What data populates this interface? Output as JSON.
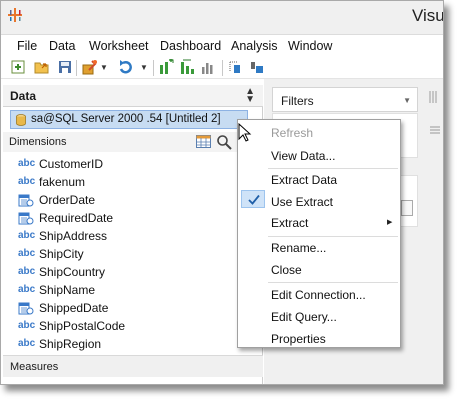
{
  "window": {
    "title_partial": "Visu"
  },
  "menubar": {
    "items": [
      "File",
      "Data",
      "Worksheet",
      "Dashboard",
      "Analysis",
      "Window"
    ]
  },
  "toolbar": {
    "icons": [
      "new-sheet-icon",
      "open-icon",
      "save-icon",
      "new-data-source-icon",
      "redo-icon",
      "swap-rows-cols-icon",
      "sort-icon",
      "bar-chart-icon",
      "group-icon",
      "label-icon"
    ]
  },
  "data_pane": {
    "title": "Data",
    "connection": "sa@SQL Server 2000 .54 [Untitled 2]",
    "dimensions_label": "Dimensions",
    "measures_label": "Measures",
    "fields": [
      {
        "type": "abc",
        "name": "CustomerID"
      },
      {
        "type": "abc",
        "name": "fakenum"
      },
      {
        "type": "date",
        "name": "OrderDate"
      },
      {
        "type": "date",
        "name": "RequiredDate"
      },
      {
        "type": "abc",
        "name": "ShipAddress"
      },
      {
        "type": "abc",
        "name": "ShipCity"
      },
      {
        "type": "abc",
        "name": "ShipCountry"
      },
      {
        "type": "abc",
        "name": "ShipName"
      },
      {
        "type": "date",
        "name": "ShippedDate"
      },
      {
        "type": "abc",
        "name": "ShipPostalCode"
      },
      {
        "type": "abc",
        "name": "ShipRegion"
      }
    ],
    "abc_glyph": "abc"
  },
  "filters": {
    "title": "Filters"
  },
  "context_menu": {
    "items": [
      {
        "label": "Refresh",
        "disabled": true
      },
      {
        "label": "View Data..."
      },
      {
        "label": "Extract Data"
      },
      {
        "label": "Use Extract",
        "checked": true
      },
      {
        "label": "Extract",
        "submenu": true
      },
      {
        "label": "Rename..."
      },
      {
        "label": "Close"
      },
      {
        "label": "Edit Connection..."
      },
      {
        "label": "Edit Query..."
      },
      {
        "label": "Properties"
      }
    ]
  },
  "colors": {
    "selection": "#c7dcf2",
    "accent_blue": "#3a79c8"
  }
}
